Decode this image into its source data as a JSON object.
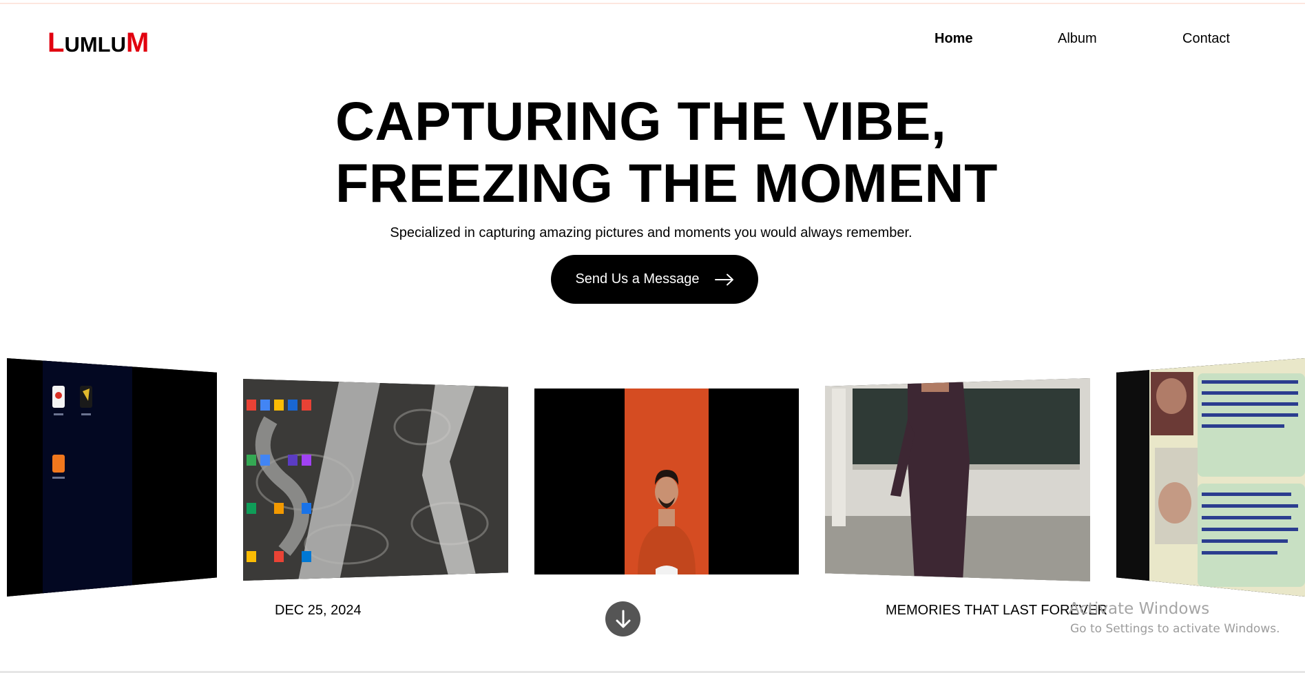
{
  "brand": {
    "first_letter": "L",
    "middle": "UMLU",
    "last_letter": "M",
    "accent_color": "#e1000f"
  },
  "nav": {
    "items": [
      {
        "label": "Home",
        "active": true
      },
      {
        "label": "Album",
        "active": false
      },
      {
        "label": "Contact",
        "active": false
      }
    ]
  },
  "hero": {
    "title_line1": "CAPTURING THE VIBE,",
    "title_line2": "FREEZING THE MOMENT",
    "subtitle": "Specialized in capturing amazing pictures and moments you would always remember.",
    "cta_label": "Send Us a Message",
    "cta_icon": "arrow-right-icon"
  },
  "gallery": {
    "photos": [
      {
        "subject": "phone-homescreen-photo"
      },
      {
        "subject": "desktop-icons-photo"
      },
      {
        "subject": "portrait-photo"
      },
      {
        "subject": "lecturer-photo"
      },
      {
        "subject": "quote-slide-photo"
      }
    ],
    "caption_left": "DEC 25, 2024",
    "caption_right": "MEMORIES THAT LAST FOREVER",
    "scroll_icon": "arrow-down-icon"
  },
  "os_watermark": {
    "title": "Activate Windows",
    "subtitle": "Go to Settings to activate Windows."
  }
}
